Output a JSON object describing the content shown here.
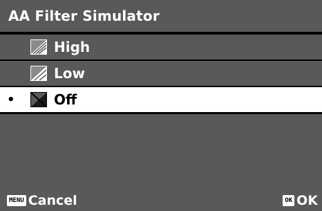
{
  "title": "AA Filter Simulator",
  "menu": {
    "items": [
      {
        "label": "High",
        "icon": "aa-filter-high-icon",
        "selected": false
      },
      {
        "label": "Low",
        "icon": "aa-filter-low-icon",
        "selected": false
      },
      {
        "label": "Off",
        "icon": "aa-filter-off-icon",
        "selected": true,
        "bullet": "•"
      }
    ]
  },
  "footer": {
    "menu_key": "MENU",
    "cancel_label": "Cancel",
    "ok_key": "OK",
    "ok_label": "OK"
  },
  "colors": {
    "panel": "#595959",
    "selected": "#ffffff",
    "background": "#000000",
    "text": "#ffffff"
  }
}
